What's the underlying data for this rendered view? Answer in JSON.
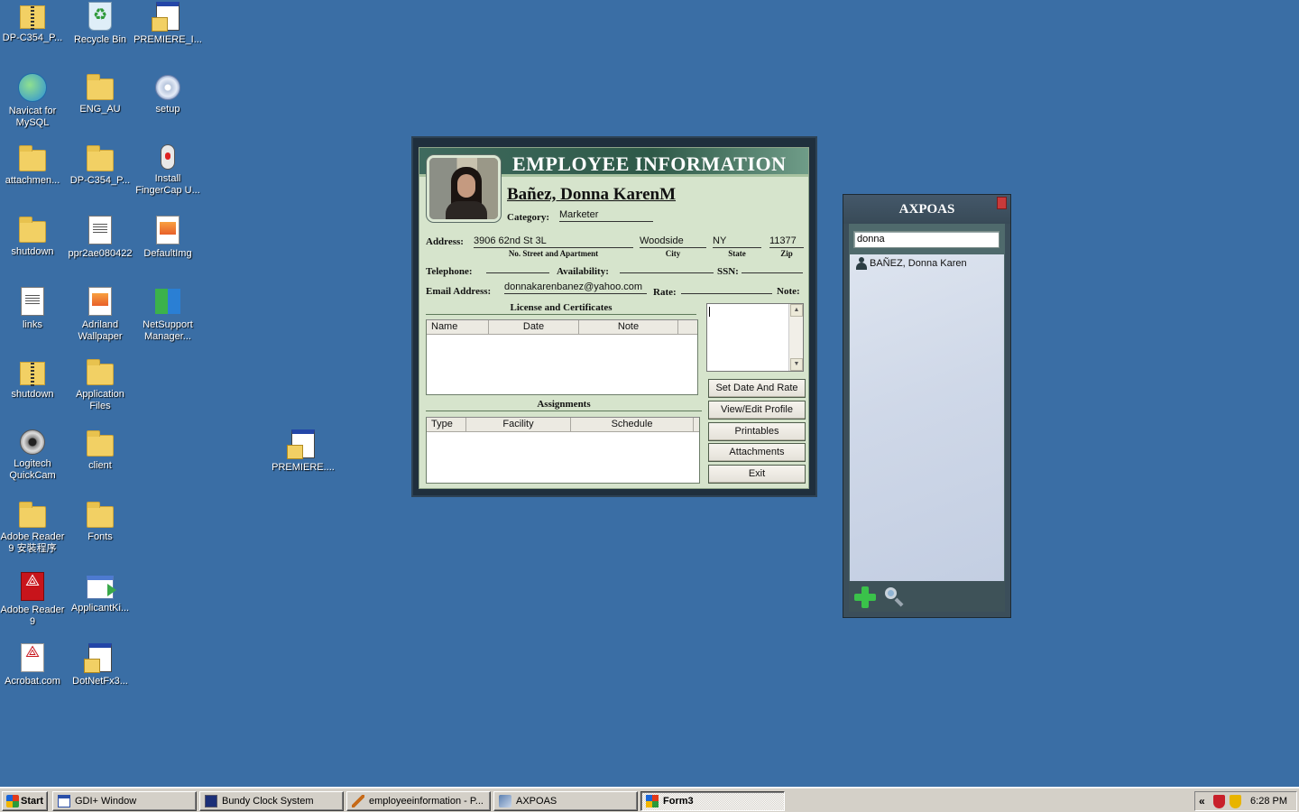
{
  "desktop": {
    "icons": [
      {
        "label": "DP-C354_P...",
        "icon": "zip-folder-icon"
      },
      {
        "label": "Recycle Bin",
        "icon": "recycle-bin-icon"
      },
      {
        "label": "PREMIERE_I...",
        "icon": "installer-window-icon"
      },
      {
        "label": "Navicat for MySQL",
        "icon": "navicat-icon"
      },
      {
        "label": "ENG_AU",
        "icon": "folder-icon"
      },
      {
        "label": "setup",
        "icon": "setup-cd-icon"
      },
      {
        "label": "attachmen...",
        "icon": "folder-icon"
      },
      {
        "label": "DP-C354_P...",
        "icon": "folder-icon"
      },
      {
        "label": "Install FingerCap U...",
        "icon": "usb-mouse-icon"
      },
      {
        "label": "shutdown",
        "icon": "folder-icon"
      },
      {
        "label": "ppr2ae080422",
        "icon": "document-icon"
      },
      {
        "label": "DefaultImg",
        "icon": "image-icon"
      },
      {
        "label": "links",
        "icon": "text-file-icon"
      },
      {
        "label": "Adriland Wallpaper",
        "icon": "image-icon"
      },
      {
        "label": "NetSupport Manager...",
        "icon": "netsupport-icon"
      },
      {
        "label": "shutdown",
        "icon": "zip-folder-icon"
      },
      {
        "label": "Application Files",
        "icon": "folder-icon"
      },
      {
        "label": "PREMIERE....",
        "icon": "installer-window-icon"
      },
      {
        "label": "Logitech QuickCam",
        "icon": "webcam-icon"
      },
      {
        "label": "client",
        "icon": "folder-icon"
      },
      {
        "label": "Adobe Reader 9 安裝程序",
        "icon": "folder-icon"
      },
      {
        "label": "Fonts",
        "icon": "folder-icon"
      },
      {
        "label": "Adobe Reader 9",
        "icon": "adobe-reader-icon"
      },
      {
        "label": "ApplicantKi...",
        "icon": "application-icon"
      },
      {
        "label": "Acrobat.com",
        "icon": "acrobat-icon"
      },
      {
        "label": "DotNetFx3...",
        "icon": "setup-window-icon"
      }
    ]
  },
  "employee_window": {
    "title": "EMPLOYEE INFORMATION",
    "name": "Bañez, Donna KarenM",
    "category_label": "Category:",
    "category_value": "Marketer",
    "address_label": "Address:",
    "street_value": "3906 62nd St 3L",
    "street_caption": "No. Street and Apartment",
    "city_value": "Woodside",
    "city_caption": "City",
    "state_value": "NY",
    "state_caption": "State",
    "zip_value": "11377",
    "zip_caption": "Zip",
    "telephone_label": "Telephone:",
    "availability_label": "Availability:",
    "ssn_label": "SSN:",
    "email_label": "Email Address:",
    "email_value": "donnakarenbanez@yahoo.com",
    "rate_label": "Rate:",
    "note_label": "Note:",
    "license_title": "License and Certificates",
    "license_columns": [
      "Name",
      "Date",
      "Note"
    ],
    "assignments_title": "Assignments",
    "assignment_columns": [
      "Type",
      "Facility",
      "Schedule"
    ],
    "buttons": {
      "set_date_rate": "Set Date And Rate",
      "view_edit_profile": "View/Edit Profile",
      "printables": "Printables",
      "attachments": "Attachments",
      "exit": "Exit"
    }
  },
  "axpoas_window": {
    "title": "AXPOAS",
    "search_value": "donna",
    "results": [
      "BAÑEZ, Donna Karen"
    ]
  },
  "taskbar": {
    "start_label": "Start",
    "buttons": [
      {
        "label": "GDI+ Window",
        "icon": "gdi-window-icon",
        "active": false
      },
      {
        "label": "Bundy Clock System",
        "icon": "clock-app-icon",
        "active": false
      },
      {
        "label": "employeeinformation - P...",
        "icon": "paint-icon",
        "active": false
      },
      {
        "label": "AXPOAS",
        "icon": "axpoas-app-icon",
        "active": false
      },
      {
        "label": "Form3",
        "icon": "form-icon",
        "active": true
      }
    ],
    "tray_expand": "«",
    "clock": "6:28 PM"
  },
  "colors": {
    "desktop_bg": "#3a6ea5",
    "form_bg": "#d6e4cc",
    "header_green": "#2e5948",
    "axpoas_frame": "#3b4e5a"
  }
}
